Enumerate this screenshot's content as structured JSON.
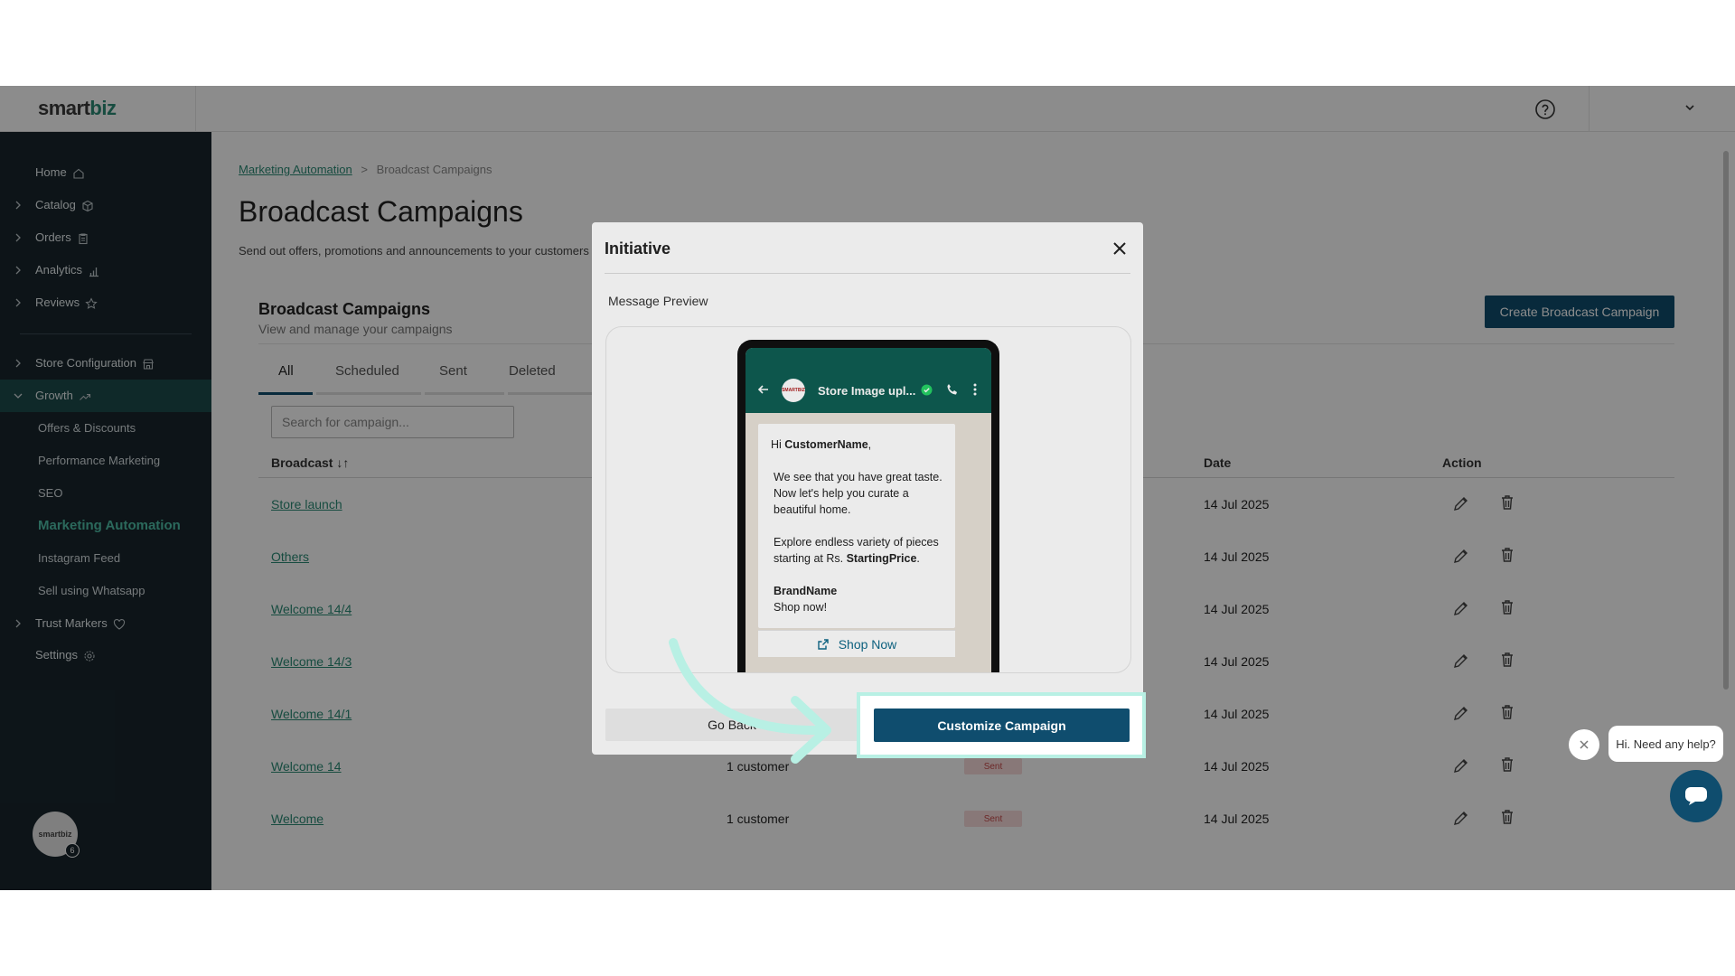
{
  "app": {
    "logo_main": "smart",
    "logo_accent": "biz",
    "avatar_text": "smartbiz",
    "avatar_badge": "6"
  },
  "sidebar": {
    "items": [
      {
        "label": "Home"
      },
      {
        "label": "Catalog"
      },
      {
        "label": "Orders"
      },
      {
        "label": "Analytics"
      },
      {
        "label": "Reviews"
      },
      {
        "label": "Store Configuration"
      },
      {
        "label": "Growth"
      },
      {
        "label": "Trust Markers"
      },
      {
        "label": "Settings"
      }
    ],
    "growth_sub": [
      {
        "label": "Offers & Discounts"
      },
      {
        "label": "Performance Marketing"
      },
      {
        "label": "SEO"
      },
      {
        "label": "Marketing Automation"
      },
      {
        "label": "Instagram Feed"
      },
      {
        "label": "Sell using Whatsapp"
      }
    ]
  },
  "breadcrumb": {
    "parent": "Marketing Automation",
    "separator": ">",
    "current": "Broadcast Campaigns"
  },
  "page": {
    "title": "Broadcast Campaigns",
    "subtitle": "Send out offers, promotions and announcements to your customers"
  },
  "card": {
    "title": "Broadcast Campaigns",
    "subtitle": "View and manage your campaigns",
    "create_button": "Create Broadcast Campaign",
    "tabs": [
      {
        "label": "All"
      },
      {
        "label": "Scheduled"
      },
      {
        "label": "Sent"
      },
      {
        "label": "Deleted"
      }
    ],
    "search_placeholder": "Search for campaign...",
    "columns": {
      "broadcast": "Broadcast ↓↑",
      "date": "Date",
      "action": "Action"
    },
    "rows": [
      {
        "name": "Store launch",
        "audience": "",
        "status": "",
        "date": "14 Jul 2025"
      },
      {
        "name": "Others",
        "audience": "",
        "status": "",
        "date": "14 Jul 2025"
      },
      {
        "name": "Welcome 14/4",
        "audience": "",
        "status": "",
        "date": "14 Jul 2025"
      },
      {
        "name": "Welcome 14/3",
        "audience": "",
        "status": "",
        "date": "14 Jul 2025"
      },
      {
        "name": "Welcome 14/1",
        "audience": "",
        "status": "",
        "date": "14 Jul 2025"
      },
      {
        "name": "Welcome 14",
        "audience": "1 customer",
        "status": "Sent",
        "date": "14 Jul 2025"
      },
      {
        "name": "Welcome",
        "audience": "1 customer",
        "status": "Sent",
        "date": "14 Jul 2025"
      }
    ]
  },
  "modal": {
    "title": "Initiative",
    "preview_label": "Message Preview",
    "whatsapp": {
      "store_name": "Store Image upl...",
      "avatar_text": "SMARTBIZ",
      "greeting_prefix": "Hi ",
      "customer_name": "CustomerName",
      "greeting_suffix": ",",
      "line1": "We see that you have great taste. Now let's help you curate a beautiful home.",
      "line2_prefix": "Explore endless variety of pieces starting at Rs. ",
      "starting_price": "StartingPrice",
      "line2_suffix": ".",
      "brand_name": "BrandName",
      "shop_text": "Shop now!",
      "cta_label": "Shop Now"
    },
    "go_back_button": "Go Back",
    "customize_button": "Customize Campaign"
  },
  "chat": {
    "help_text": "Hi. Need any help?"
  },
  "colors": {
    "sidebar_bg": "#18262d",
    "accent": "#2a8a75",
    "primary_button": "#0f4d6e",
    "highlight": "#b8f0e4",
    "sent_badge_bg": "#f7dada",
    "sent_badge_text": "#c64a4a",
    "whatsapp_header": "#0f5e53"
  }
}
